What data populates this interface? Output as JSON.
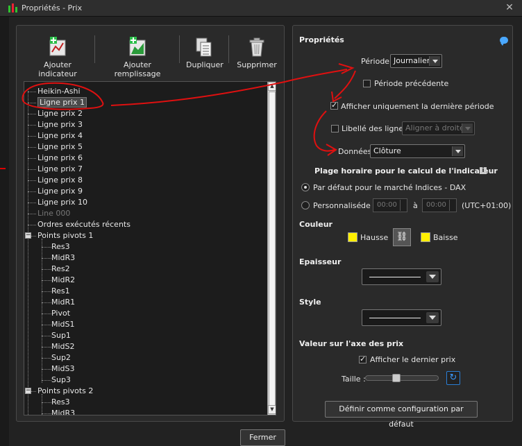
{
  "window": {
    "title": "Propriétés - Prix",
    "close_glyph": "✕"
  },
  "toolbar": {
    "add_indicator": "Ajouter indicateur",
    "add_fill": "Ajouter remplissage",
    "duplicate": "Dupliquer",
    "delete": "Supprimer"
  },
  "tree": {
    "items": [
      {
        "label": "Heikin-Ashi"
      },
      {
        "label": "Ligne prix 1"
      },
      {
        "label": "Ligne prix 2"
      },
      {
        "label": "Ligne prix 3"
      },
      {
        "label": "Ligne prix 4"
      },
      {
        "label": "Ligne prix 5"
      },
      {
        "label": "Ligne prix 6"
      },
      {
        "label": "Ligne prix 7"
      },
      {
        "label": "Ligne prix 8"
      },
      {
        "label": "Ligne prix 9"
      },
      {
        "label": "Ligne prix 10"
      },
      {
        "label": "Line 000"
      },
      {
        "label": "Ordres exécutés récents"
      },
      {
        "label": "Points pivots 1"
      },
      {
        "label": "Res3"
      },
      {
        "label": "MidR3"
      },
      {
        "label": "Res2"
      },
      {
        "label": "MidR2"
      },
      {
        "label": "Res1"
      },
      {
        "label": "MidR1"
      },
      {
        "label": "Pivot"
      },
      {
        "label": "MidS1"
      },
      {
        "label": "Sup1"
      },
      {
        "label": "MidS2"
      },
      {
        "label": "Sup2"
      },
      {
        "label": "MidS3"
      },
      {
        "label": "Sup3"
      },
      {
        "label": "Points pivots 2"
      },
      {
        "label": "Res3"
      },
      {
        "label": "MidR3"
      }
    ],
    "expander_glyph": "−"
  },
  "props": {
    "title": "Propriétés",
    "periode_label": "Période",
    "periode_value": "Journalier",
    "prev_period_label": "Période précédente",
    "prev_period_checked": false,
    "last_period_label": "Afficher uniquement la dernière période",
    "last_period_checked": true,
    "line_labels_label": "Libellé des lignes",
    "line_labels_checked": false,
    "line_labels_value": "Aligner à droite",
    "donnees_label": "Données",
    "donnees_value": "Clôture",
    "hours_title": "Plage horaire pour le calcul de l'indicateur",
    "info_glyph": "i",
    "default_hours_label": "Par défaut pour le marché Indices - DAX",
    "custom_label": "Personnalisé",
    "from_label": "de",
    "from_value": "00:00",
    "to_label": "à",
    "to_value": "00:00",
    "timezone": "(UTC+01:00)",
    "color_title": "Couleur",
    "up_label": "Hausse",
    "down_label": "Baisse",
    "up_color": "#ffef00",
    "down_color": "#ffef00",
    "link_glyph": "⛓",
    "thickness_title": "Epaisseur",
    "style_title": "Style",
    "axis_title": "Valeur sur l'axe des prix",
    "show_last_price_label": "Afficher le dernier prix",
    "show_last_price_checked": true,
    "size_label": "Taille :",
    "reset_glyph": "↻",
    "set_default_button": "Définir comme configuration par défaut"
  },
  "footer": {
    "close_button": "Fermer"
  }
}
